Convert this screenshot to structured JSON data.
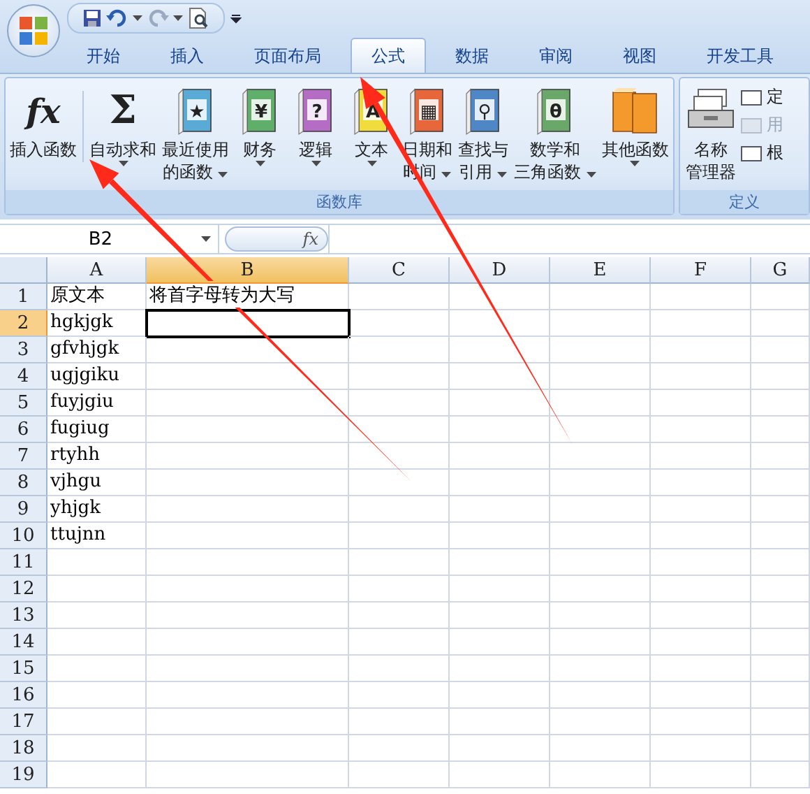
{
  "tabs": [
    {
      "label": "开始",
      "selected": false
    },
    {
      "label": "插入",
      "selected": false
    },
    {
      "label": "页面布局",
      "selected": false
    },
    {
      "label": "公式",
      "selected": true
    },
    {
      "label": "数据",
      "selected": false
    },
    {
      "label": "审阅",
      "selected": false
    },
    {
      "label": "视图",
      "selected": false
    },
    {
      "label": "开发工具",
      "selected": false
    }
  ],
  "ribbon": {
    "groups": [
      {
        "label": "函数库",
        "buttons": [
          {
            "kind": "glyph",
            "glyph": "fx",
            "label_lines": [
              "插入函数"
            ],
            "dropdown": false
          },
          {
            "kind": "glyph",
            "glyph": "Σ",
            "label_lines": [
              "自动求和"
            ],
            "dropdown": true
          },
          {
            "kind": "book",
            "color": "#5aaad6",
            "glyph": "★",
            "label_lines": [
              "最近使用",
              "的函数"
            ],
            "dropdown": true
          },
          {
            "kind": "book",
            "color": "#5fae6a",
            "glyph": "¥",
            "label_lines": [
              "财务"
            ],
            "dropdown": true
          },
          {
            "kind": "book",
            "color": "#b56cc4",
            "glyph": "?",
            "label_lines": [
              "逻辑"
            ],
            "dropdown": true
          },
          {
            "kind": "book",
            "color": "#f0dc3c",
            "glyph": "A",
            "label_lines": [
              "文本"
            ],
            "dropdown": true
          },
          {
            "kind": "book",
            "color": "#e8673a",
            "glyph": "▦",
            "label_lines": [
              "日期和",
              "时间"
            ],
            "dropdown": true
          },
          {
            "kind": "book",
            "color": "#4f86c6",
            "glyph": "⚲",
            "label_lines": [
              "查找与",
              "引用"
            ],
            "dropdown": true
          },
          {
            "kind": "book",
            "color": "#6aa86a",
            "glyph": "θ",
            "label_lines": [
              "数学和",
              "三角函数"
            ],
            "dropdown": true
          },
          {
            "kind": "books",
            "color": "#f49a2c",
            "label_lines": [
              "其他函数"
            ],
            "dropdown": true
          }
        ]
      },
      {
        "label": "定义",
        "buttons": [
          {
            "kind": "cards",
            "label_lines": [
              "名称",
              "管理器"
            ],
            "dropdown": false
          }
        ],
        "small_items": [
          {
            "label": "定",
            "disabled": false
          },
          {
            "label": "用",
            "disabled": true
          },
          {
            "label": "根",
            "disabled": false
          }
        ]
      }
    ]
  },
  "formula_bar": {
    "name_box": "B2",
    "formula": "fx"
  },
  "columns": [
    {
      "label": "A",
      "selected": false
    },
    {
      "label": "B",
      "selected": true
    },
    {
      "label": "C",
      "selected": false
    },
    {
      "label": "D",
      "selected": false
    },
    {
      "label": "E",
      "selected": false
    },
    {
      "label": "F",
      "selected": false
    },
    {
      "label": "G",
      "selected": false
    }
  ],
  "rows": [
    {
      "label": "1",
      "selected": false,
      "cells": [
        "原文本",
        "将首字母转为大写"
      ]
    },
    {
      "label": "2",
      "selected": true,
      "cells": [
        "hgkjgk",
        ""
      ]
    },
    {
      "label": "3",
      "selected": false,
      "cells": [
        "gfvhjgk"
      ]
    },
    {
      "label": "4",
      "selected": false,
      "cells": [
        "ugjgiku"
      ]
    },
    {
      "label": "5",
      "selected": false,
      "cells": [
        "fuyjgiu"
      ]
    },
    {
      "label": "6",
      "selected": false,
      "cells": [
        "fugiug"
      ]
    },
    {
      "label": "7",
      "selected": false,
      "cells": [
        "rtyhh"
      ]
    },
    {
      "label": "8",
      "selected": false,
      "cells": [
        "vjhgu"
      ]
    },
    {
      "label": "9",
      "selected": false,
      "cells": [
        "yhjgk"
      ]
    },
    {
      "label": "10",
      "selected": false,
      "cells": [
        "ttujnn"
      ]
    },
    {
      "label": "11",
      "selected": false,
      "cells": []
    },
    {
      "label": "12",
      "selected": false,
      "cells": []
    },
    {
      "label": "13",
      "selected": false,
      "cells": []
    },
    {
      "label": "14",
      "selected": false,
      "cells": []
    },
    {
      "label": "15",
      "selected": false,
      "cells": []
    },
    {
      "label": "16",
      "selected": false,
      "cells": []
    },
    {
      "label": "17",
      "selected": false,
      "cells": []
    },
    {
      "label": "18",
      "selected": false,
      "cells": []
    },
    {
      "label": "19",
      "selected": false,
      "cells": []
    }
  ],
  "annotations": [
    {
      "kind": "arrow",
      "color": "#ff2a1a"
    },
    {
      "kind": "arrow",
      "color": "#ff2a1a"
    }
  ]
}
